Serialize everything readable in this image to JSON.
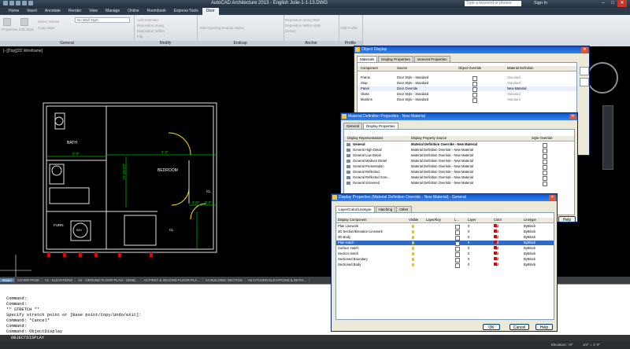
{
  "app": {
    "title": "AutoCAD Architecture 2013 - English   Julie-1-1-13.DWG",
    "search_placeholder": "Type a keyword or phrase",
    "sign_in": "Sign In"
  },
  "ribbon": {
    "tabs": [
      "Home",
      "Insert",
      "Annotate",
      "Render",
      "View",
      "Manage",
      "Online",
      "Roombook",
      "Express Tools",
      "Door"
    ],
    "active_tab": "Door",
    "panels": [
      {
        "title": "General",
        "buttons": [
          "Properties",
          "Edit Style",
          "Select Similar",
          "Copy Style"
        ]
      },
      {
        "title": "Modify",
        "buttons": [
          "Add Selected",
          "Reposition Along",
          "Reposition Within",
          "Flip"
        ]
      },
      {
        "title": "Endcap",
        "buttons": [
          "Edit Opening Endcap Styles"
        ]
      },
      {
        "title": "Anchor",
        "buttons": [
          "Reposition Along Wall",
          "Reposition Within Wall",
          "Center"
        ]
      },
      {
        "title": "Profile",
        "buttons": [
          "Add Profile"
        ]
      }
    ],
    "style_dropdown": "No Wall Style"
  },
  "viewport": {
    "label": "[−][Top][2D Wireframe]"
  },
  "drawing_labels": {
    "bath": "BATH",
    "bedroom": "BEDROOM",
    "furn": "FURN",
    "wh": "WH",
    "cl1": "CL",
    "cl2": "CL",
    "dim1": "5'-0\"",
    "dim2": "5'-0\"",
    "dim3": "10'-10 1/2\"",
    "dim4": "2'-6\"",
    "dim5": "3'-0\""
  },
  "layout_tabs": [
    "Model",
    "COVER PAGE",
    "A1 - ELEVATIONS",
    "A2 - GROUND FLOOR PLAN - GENE...",
    "A3.FIRST & SECOND FLOOR PLA...",
    "A4 BUILDING SECTION",
    "A5 KITCHEN ELEVATIONS & DETAI..."
  ],
  "command_history": [
    "Command:",
    "Command:",
    "** STRETCH **",
    "Specify stretch point or [Base point/Copy/Undo/eXit]:",
    "Command: *Cancel*",
    "Command:",
    "Command: ObjectDisplay"
  ],
  "command_input": "OBJECTDISPLAY",
  "status": {
    "coords": "Elevation: +0\"",
    "scale": "1/4\" = 1'-0\""
  },
  "object_display": {
    "title": "Object Display",
    "tabs": [
      "Materials",
      "Display Properties",
      "General Properties"
    ],
    "active_tab": "Materials",
    "headers": [
      "Component",
      "Source",
      "Object Override",
      "Material Definition"
    ],
    "rows": [
      {
        "component": "Frame",
        "source": "Door Style - Standard",
        "material": "Standard",
        "override": false
      },
      {
        "component": "Stop",
        "source": "Door Style - Standard",
        "material": "Standard",
        "override": false
      },
      {
        "component": "Panel",
        "source": "Door Override",
        "material": "New Material",
        "override": true
      },
      {
        "component": "Glass",
        "source": "Door Style - Standard",
        "material": "Standard",
        "override": false
      },
      {
        "component": "Muntins",
        "source": "Door Style - Standard",
        "material": "Standard",
        "override": false
      }
    ]
  },
  "material_props": {
    "title": "Material Definition Properties - New Material",
    "tabs": [
      "General",
      "Display Properties"
    ],
    "active_tab": "Display Properties",
    "headers": [
      "Display Representations",
      "Display Property Source",
      "Style Override"
    ],
    "rows": [
      {
        "rep": "General",
        "source": "Material Definition Override - New Material",
        "bold": true
      },
      {
        "rep": "General High Detail",
        "source": "Material Definition Override - New Material",
        "bold": false
      },
      {
        "rep": "General Low Detail",
        "source": "Material Definition Override - New Material",
        "bold": false
      },
      {
        "rep": "General Medium Detail",
        "source": "Material Definition Override - New Material",
        "bold": false
      },
      {
        "rep": "General Presentation",
        "source": "Material Definition Override - New Material",
        "bold": false
      },
      {
        "rep": "General Reflected",
        "source": "Material Definition Override - New Material",
        "bold": false
      },
      {
        "rep": "General Reflected Scre...",
        "source": "Material Definition Override - New Material",
        "bold": false
      },
      {
        "rep": "General Screened",
        "source": "Material Definition Override - New Material",
        "bold": false
      }
    ],
    "help": "Help"
  },
  "display_props": {
    "title": "Display Properties (Material Definition Override - New Material) - General",
    "tabs": [
      "Layer/Color/Linetype",
      "Hatching",
      "Other"
    ],
    "active_tab": "Layer/Color/Linetype",
    "headers": [
      "Display Component",
      "Visible",
      "Layer/Key",
      "L...",
      "Layer",
      "Color",
      "Linetype"
    ],
    "rows": [
      {
        "name": "Plan Linework",
        "color": "red",
        "linetype": "ByBlock",
        "layer": "0",
        "selected": false
      },
      {
        "name": "3D Section/Elevation Linework",
        "color": "red",
        "linetype": "ByBlock",
        "layer": "0",
        "selected": false
      },
      {
        "name": "3D Body",
        "color": "red",
        "linetype": "ByBlock",
        "layer": "0",
        "selected": false
      },
      {
        "name": "Plan Hatch",
        "color": "red",
        "linetype": "ByBlock",
        "layer": "0",
        "selected": true
      },
      {
        "name": "Surface Hatch",
        "color": "red",
        "linetype": "ByBlock",
        "layer": "0",
        "selected": false
      },
      {
        "name": "Section Hatch",
        "color": "red",
        "linetype": "ByBlock",
        "layer": "0",
        "selected": false
      },
      {
        "name": "Sectioned Boundary",
        "color": "red",
        "linetype": "ByBlock",
        "layer": "0",
        "selected": false
      },
      {
        "name": "Sectioned Body",
        "color": "red",
        "linetype": "ByBlock",
        "layer": "0",
        "selected": false
      }
    ],
    "ok": "OK",
    "cancel": "Cancel",
    "help": "Help"
  }
}
